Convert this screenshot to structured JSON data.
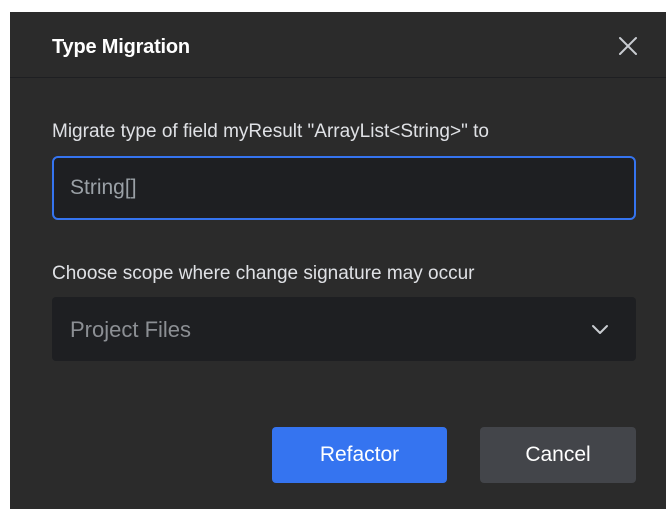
{
  "dialog": {
    "title": "Type Migration",
    "close_icon": "close-icon"
  },
  "migration": {
    "label": "Migrate type of field myResult \"ArrayList<String>\" to",
    "type_value": "String[]"
  },
  "scope": {
    "label": "Choose scope where change signature may occur",
    "selected": "Project Files",
    "dropdown_icon": "chevron-down-icon"
  },
  "buttons": {
    "refactor": "Refactor",
    "cancel": "Cancel"
  },
  "colors": {
    "dialog_background": "#2b2b2b",
    "field_background": "#1e1f22",
    "accent": "#3574f0",
    "secondary_button": "#43454a"
  }
}
